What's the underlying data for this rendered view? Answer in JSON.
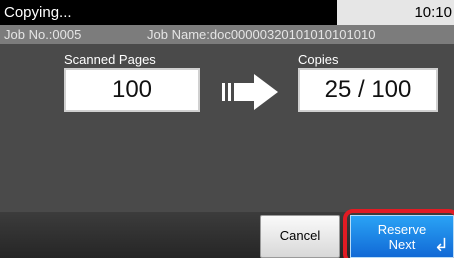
{
  "status": {
    "title": "Copying...",
    "time": "10:10"
  },
  "job": {
    "number": "Job No.:0005",
    "name": "Job Name:doc00000320101010101010"
  },
  "scanned": {
    "label": "Scanned Pages",
    "value": "100"
  },
  "copies": {
    "label": "Copies",
    "value": "25 / 100"
  },
  "buttons": {
    "cancel": "Cancel",
    "reserve_line1": "Reserve",
    "reserve_line2": "Next",
    "enter_icon": "↲"
  },
  "icons": {
    "arrow": "right-arrow-icon"
  },
  "colors": {
    "accent_blue": "#1e8ae8",
    "highlight_red": "#e21b23",
    "status_bar": "#000000"
  }
}
